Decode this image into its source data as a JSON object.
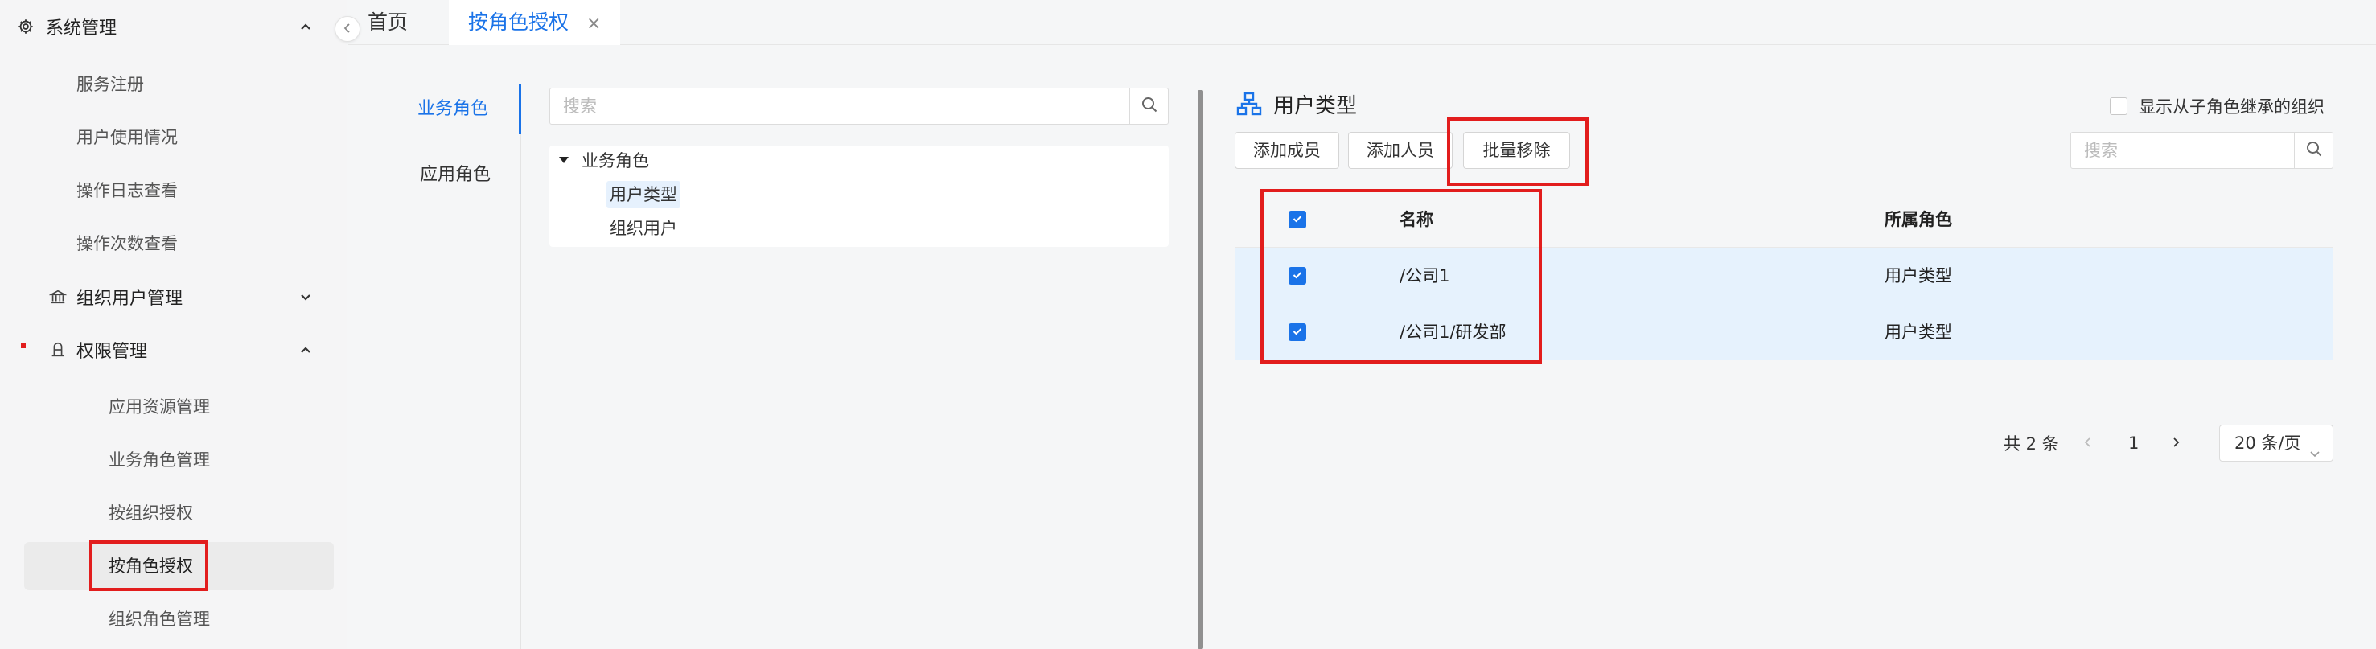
{
  "sidebar": {
    "groups": {
      "system": {
        "label": "系统管理"
      },
      "org_users": {
        "label": "组织用户管理"
      },
      "permission": {
        "label": "权限管理"
      }
    },
    "system_items": [
      "服务注册",
      "用户使用情况",
      "操作日志查看",
      "操作次数查看"
    ],
    "permission_items": [
      "应用资源管理",
      "业务角色管理",
      "按组织授权",
      "按角色授权",
      "组织角色管理"
    ],
    "active_item": "按角色授权"
  },
  "tabs": {
    "home": "首页",
    "current": "按角色授权",
    "close_glyph": "×"
  },
  "role_tabs": [
    "业务角色",
    "应用角色"
  ],
  "left_search": {
    "placeholder": "搜索"
  },
  "tree": {
    "root": "业务角色",
    "children": [
      "用户类型",
      "组织用户"
    ],
    "selected": "用户类型"
  },
  "right": {
    "title": "用户类型",
    "inherit_label": "显示从子角色继承的组织",
    "buttons": {
      "add_member": "添加成员",
      "add_person": "添加人员",
      "batch_remove": "批量移除"
    },
    "search_placeholder": "搜索",
    "table": {
      "headers": {
        "name": "名称",
        "role": "所属角色"
      },
      "rows": [
        {
          "name": "/公司1",
          "role": "用户类型",
          "checked": true
        },
        {
          "name": "/公司1/研发部",
          "role": "用户类型",
          "checked": true
        }
      ]
    },
    "pager": {
      "total": "共 2 条",
      "page": "1",
      "page_size": "20 条/页"
    }
  },
  "colors": {
    "accent": "#1a73e8",
    "highlight": "#e21d1d",
    "row_selected": "#e6f2fd"
  },
  "icons": [
    "gear-icon",
    "bank-icon",
    "user-shield-icon",
    "chevron-up-icon",
    "chevron-down-icon",
    "chevron-left-icon",
    "search-icon",
    "org-tree-icon",
    "close-icon",
    "caret-down-icon",
    "check-icon"
  ]
}
